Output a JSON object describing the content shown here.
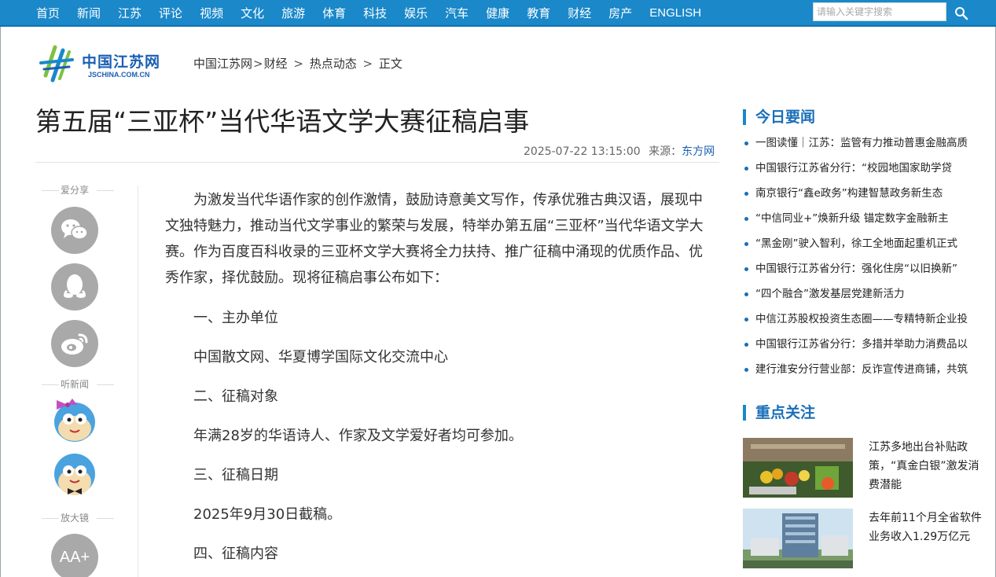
{
  "nav": {
    "items": [
      "首页",
      "新闻",
      "江苏",
      "评论",
      "视频",
      "文化",
      "旅游",
      "体育",
      "科技",
      "娱乐",
      "汽车",
      "健康",
      "教育",
      "财经",
      "房产",
      "ENGLISH"
    ],
    "search_placeholder": "请输入关键字搜索"
  },
  "logo": {
    "cn": "中国江苏网",
    "en": "JSCHINA.COM.CN"
  },
  "breadcrumb": {
    "items": [
      "中国江苏网",
      "财经",
      "热点动态",
      "正文"
    ],
    "seps": [
      ">",
      ">",
      ">"
    ]
  },
  "article": {
    "title": "第五届“三亚杯”当代华语文学大赛征稿启事",
    "datetime": "2025-07-22 13:15:00",
    "source_label": "来源：",
    "source": "东方网",
    "lead": "为激发当代华语作家的创作激情，鼓励诗意美文写作，传承优雅古典汉语，展现中文独特魅力，推动当代文学事业的繁荣与发展，特举办第五届“三亚杯”当代华语文学大赛。作为百度百科收录的三亚杯文学大赛将全力扶持、推广征稿中涌现的优质作品、优秀作家，择优鼓励。现将征稿启事公布如下：",
    "paragraphs": [
      "一、主办单位",
      "中国散文网、华夏博学国际文化交流中心",
      "二、征稿对象",
      "年满28岁的华语诗人、作家及文学爱好者均可参加。",
      "三、征稿日期",
      "2025年9月30日截稿。",
      "四、征稿内容"
    ]
  },
  "share": {
    "share_label": "爱分享",
    "listen_label": "听新闻",
    "zoom_label": "放大镜",
    "zoom_glyph": "AA+"
  },
  "sidebar": {
    "today_title": "今日要闻",
    "today_items": [
      "一图读懂｜江苏：监管有力推动普惠金融高质",
      "中国银行江苏省分行：“校园地国家助学贷",
      "南京银行“鑫e政务”构建智慧政务新生态",
      "“中信同业+”焕新升级 锚定数字金融新主",
      "“黑金刚”驶入智利，徐工全地面起重机正式",
      "中国银行江苏省分行：强化住房“以旧换新”",
      "“四个融合”激发基层党建新活力",
      "中信江苏股权投资生态圈——专精特新企业投",
      "中国银行江苏省分行：多措并举助力消费品以",
      "建行淮安分行营业部：反诈宣传进商铺，共筑"
    ],
    "focus_title": "重点关注",
    "focus_items": [
      "江苏多地出台补贴政策，“真金白银”激发消费潜能",
      "去年前11个月全省软件业务收入1.29万亿元"
    ]
  },
  "colors": {
    "nav_bg": "#1a88c9",
    "accent": "#1a6fb9"
  }
}
